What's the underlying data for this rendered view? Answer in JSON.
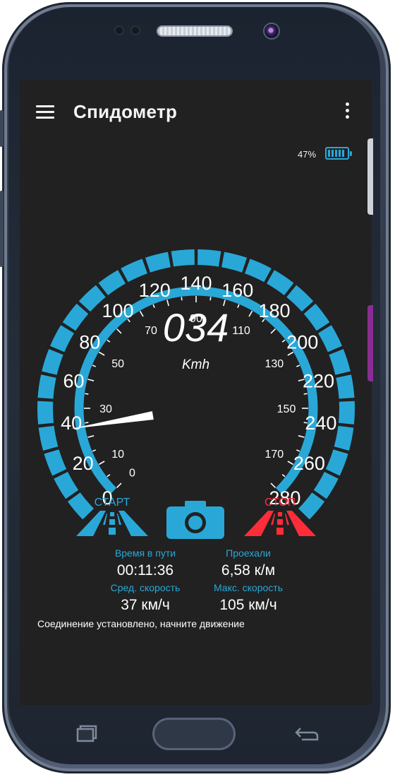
{
  "app": {
    "title": "Спидометр"
  },
  "battery": {
    "percent_text": "47%",
    "level": 0.47
  },
  "gauge": {
    "outer_labels": [
      "0",
      "20",
      "40",
      "60",
      "80",
      "100",
      "120",
      "140",
      "160",
      "180",
      "200",
      "220",
      "240",
      "260",
      "280"
    ],
    "inner_labels": [
      "0",
      "10",
      "30",
      "50",
      "70",
      "90",
      "110",
      "130",
      "150",
      "170"
    ],
    "speed": "034",
    "unit": "Kmh",
    "needle_value": 37
  },
  "controls": {
    "start_label": "СТАРТ",
    "stop_label": "СТОП",
    "start_color": "#29a8d8",
    "stop_color": "#ff2d3a"
  },
  "stats": {
    "travel_time_label": "Время в пути",
    "travel_time_value": "00:11:36",
    "distance_label": "Проехали",
    "distance_value": "6,58 к/м",
    "avg_speed_label": "Сред. скорость",
    "avg_speed_value": "37 км/ч",
    "max_speed_label": "Макс. скорость",
    "max_speed_value": "105 км/ч"
  },
  "status": {
    "message": "Соединение установлено, начните движение"
  },
  "colors": {
    "accent": "#29a8d8",
    "background": "#212121"
  }
}
